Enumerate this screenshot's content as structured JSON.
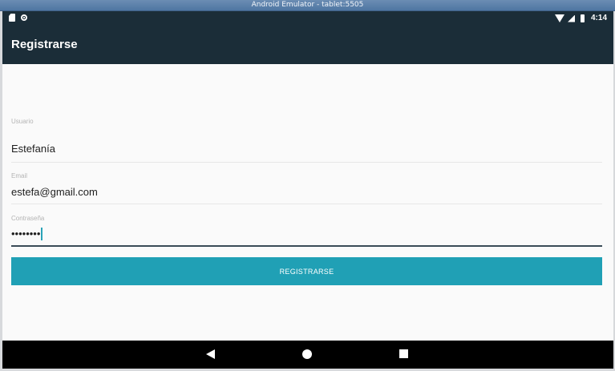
{
  "window": {
    "title": "Android Emulator - tablet:5505"
  },
  "status_bar": {
    "left_icons": [
      "sd-card-icon",
      "record-icon"
    ],
    "right_icons": [
      "wifi-icon",
      "signal-icon",
      "battery-icon"
    ],
    "time": "4:14"
  },
  "app_bar": {
    "title": "Registrarse"
  },
  "form": {
    "username": {
      "label": "Usuario",
      "value": "Estefanía"
    },
    "email": {
      "label": "Email",
      "value": "estefa@gmail.com"
    },
    "password": {
      "label": "Contraseña",
      "value": "••••••••"
    },
    "submit_label": "REGISTRARSE"
  },
  "colors": {
    "app_bar": "#1b2d38",
    "button": "#20a0b5",
    "background": "#fafafa"
  },
  "nav_bar": {
    "icons": [
      "back-icon",
      "home-icon",
      "recents-icon"
    ]
  }
}
